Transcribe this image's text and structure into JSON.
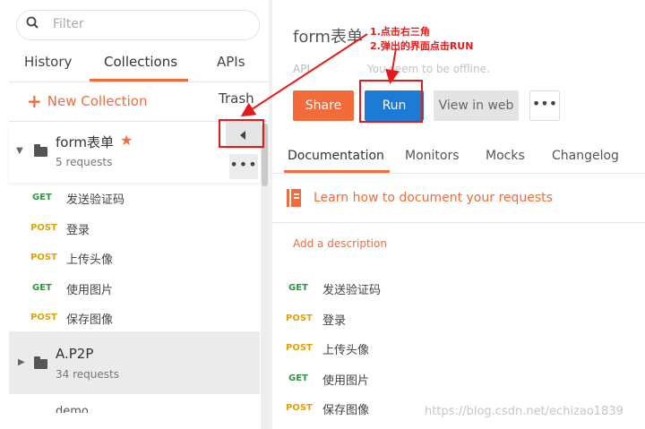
{
  "sidebar": {
    "search_placeholder": "Filter",
    "tabs": [
      "History",
      "Collections",
      "APIs"
    ],
    "new_collection_label": "New Collection",
    "trash_label": "Trash",
    "more_glyph": "•••",
    "collections": [
      {
        "name": "form表单",
        "count": "5 requests",
        "favorite": true,
        "requests": [
          {
            "method": "GET",
            "name": "发送验证码"
          },
          {
            "method": "POST",
            "name": "登录"
          },
          {
            "method": "POST",
            "name": "上传头像"
          },
          {
            "method": "GET",
            "name": "使用图片"
          },
          {
            "method": "POST",
            "name": "保存图像"
          }
        ]
      },
      {
        "name": "A.P2P",
        "count": "34 requests"
      },
      {
        "name": "demo"
      }
    ]
  },
  "main": {
    "title": "form表单",
    "subtitle": "API",
    "offline_text": "You seem to be offline.",
    "buttons": {
      "share": "Share",
      "run": "Run",
      "view_web": "View in web",
      "more": "•••"
    },
    "tabs": [
      "Documentation",
      "Monitors",
      "Mocks",
      "Changelog"
    ],
    "learn_link": "Learn how to document your requests",
    "add_description": "Add a description",
    "requests": [
      {
        "method": "GET",
        "name": "发送验证码"
      },
      {
        "method": "POST",
        "name": "登录"
      },
      {
        "method": "POST",
        "name": "上传头像"
      },
      {
        "method": "GET",
        "name": "使用图片"
      },
      {
        "method": "POST",
        "name": "保存图像"
      }
    ]
  },
  "annotations": {
    "step1": "1.点击右三角",
    "step2": "2.弹出的界面点击RUN",
    "color": "#e8191a"
  },
  "watermark": "https://blog.csdn.net/echizao1839",
  "colors": {
    "accent": "#f26b3a",
    "run_blue": "#1c7cd5",
    "get_green": "#2a9a3d",
    "post_yellow": "#e6a100"
  }
}
